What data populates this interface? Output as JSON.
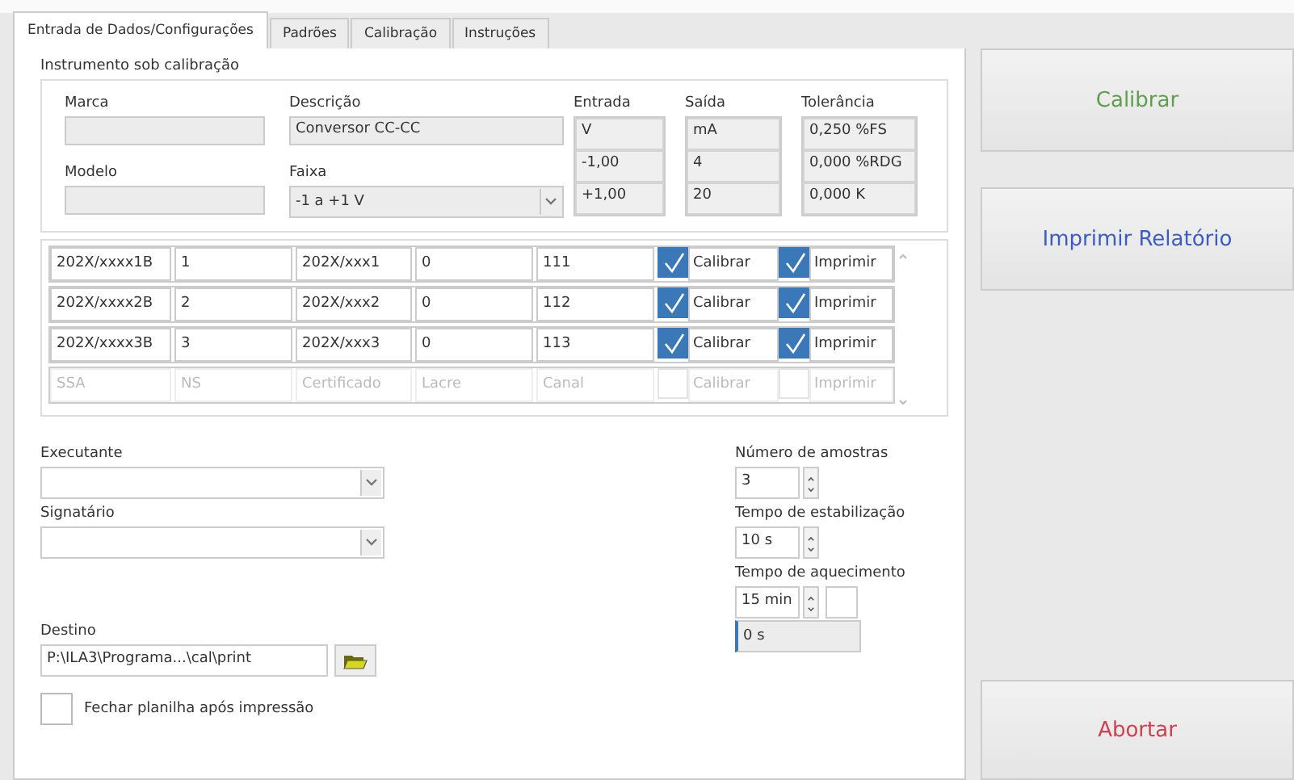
{
  "tabs": [
    {
      "label": "Entrada de Dados/Configurações",
      "selected": true
    },
    {
      "label": "Padrões",
      "selected": false
    },
    {
      "label": "Calibração",
      "selected": false
    },
    {
      "label": "Instruções",
      "selected": false
    }
  ],
  "instrument": {
    "title": "Instrumento sob calibração",
    "marca": {
      "label": "Marca"
    },
    "modelo": {
      "label": "Modelo"
    },
    "descricao": {
      "label": "Descrição",
      "value": "Conversor CC-CC"
    },
    "faixa": {
      "label": "Faixa",
      "value": "-1 a +1 V"
    },
    "columns": [
      {
        "label": "Entrada",
        "values": [
          "V",
          "-1,00",
          "+1,00"
        ]
      },
      {
        "label": "Saída",
        "values": [
          "mA",
          "4",
          "20"
        ]
      },
      {
        "label": "Tolerância",
        "values": [
          "0,250 %FS",
          "0,000 %RDG",
          "0,000 K"
        ]
      }
    ]
  },
  "table": {
    "rows": [
      {
        "kind": "entry",
        "cells": [
          "202X/xxxx1B",
          "1",
          "202X/xxx1",
          "0",
          "111"
        ],
        "calibrar": {
          "label": "Calibrar",
          "checked": true
        },
        "imprimir": {
          "label": "Imprimir",
          "checked": true
        }
      },
      {
        "kind": "entry",
        "cells": [
          "202X/xxxx2B",
          "2",
          "202X/xxx2",
          "0",
          "112"
        ],
        "calibrar": {
          "label": "Calibrar",
          "checked": true
        },
        "imprimir": {
          "label": "Imprimir",
          "checked": true
        }
      },
      {
        "kind": "entry",
        "cells": [
          "202X/xxxx3B",
          "3",
          "202X/xxx3",
          "0",
          "113"
        ],
        "calibrar": {
          "label": "Calibrar",
          "checked": true
        },
        "imprimir": {
          "label": "Imprimir",
          "checked": true
        }
      },
      {
        "kind": "placeholder",
        "cells": [
          "SSA",
          "NS",
          "Certificado",
          "Lacre",
          "Canal"
        ],
        "calibrar": {
          "label": "Calibrar",
          "checked": false
        },
        "imprimir": {
          "label": "Imprimir",
          "checked": false
        }
      }
    ]
  },
  "executante": {
    "label": "Executante"
  },
  "signatario": {
    "label": "Signatário"
  },
  "destino": {
    "label": "Destino",
    "value": "P:\\ILA3\\Programa...\\cal\\print"
  },
  "fechar": {
    "label": "Fechar planilha após impressão",
    "checked": false
  },
  "spinners": [
    {
      "label": "Número de amostras",
      "value": "3"
    },
    {
      "label": "Tempo de estabilização",
      "value": "10 s"
    },
    {
      "label": "Tempo de aquecimento",
      "value": "15 min"
    }
  ],
  "aquecimento_elapsed": "0 s",
  "buttons": [
    {
      "label": "Calibrar",
      "color": "#5e9e4c"
    },
    {
      "label": "Imprimir Relatório",
      "color": "#3b5cc4"
    },
    {
      "label": "Abortar",
      "color": "#d0404e"
    }
  ]
}
